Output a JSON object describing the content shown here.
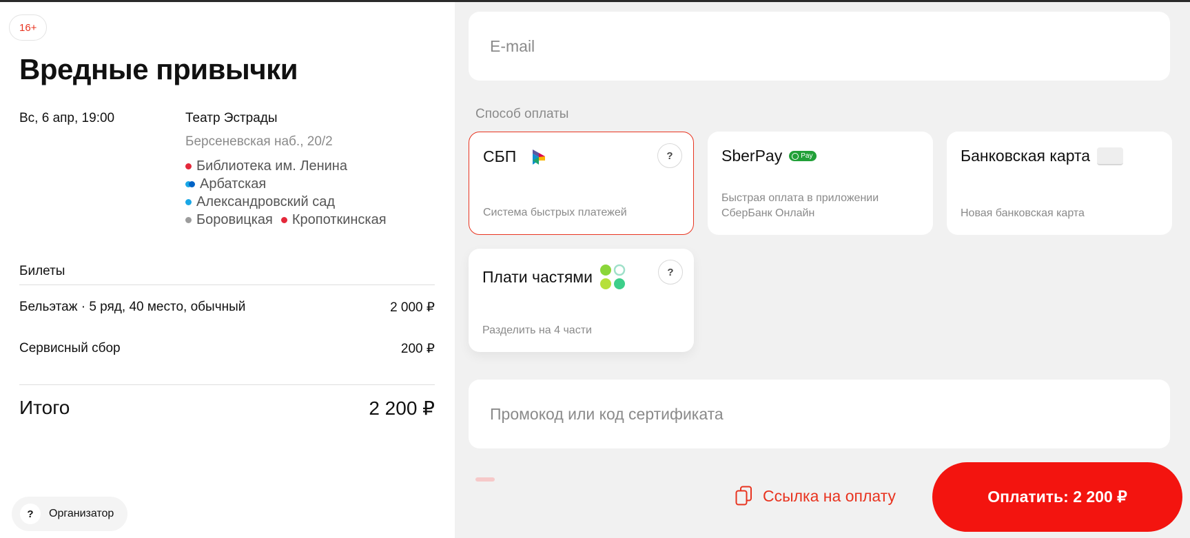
{
  "event": {
    "age_rating": "16+",
    "title": "Вредные привычки",
    "date": "Вс, 6 апр, 19:00",
    "venue_name": "Театр Эстрады",
    "venue_address": "Берсеневская наб., 20/2",
    "metro": [
      {
        "name": "Библиотека им. Ленина",
        "color": "#e4283a"
      },
      {
        "name": "Арбатская",
        "color": "#1aa7e6"
      },
      {
        "name": "Александровский сад",
        "color": "#1aa7e6"
      },
      {
        "name": "Боровицкая",
        "color": "#9c9c9c"
      },
      {
        "name": "Кропоткинская",
        "color": "#e4283a"
      }
    ]
  },
  "order": {
    "tickets_label": "Билеты",
    "ticket_description": "Бельэтаж · 5 ряд, 40 место, обычный",
    "ticket_price": "2 000 ₽",
    "service_fee_label": "Сервисный сбор",
    "service_fee_price": "200 ₽",
    "total_label": "Итого",
    "total_price": "2 200 ₽"
  },
  "organizer": {
    "icon": "?",
    "label": "Организатор"
  },
  "form": {
    "email_placeholder": "E-mail",
    "payment_method_label": "Способ оплаты",
    "payment_methods": [
      {
        "id": "sbp",
        "title": "СБП",
        "description": "Система быстрых платежей",
        "selected": true,
        "help": "?"
      },
      {
        "id": "sberpay",
        "title": "SberPay",
        "badge": "Pay",
        "description": "Быстрая оплата в приложении СберБанк Онлайн",
        "selected": false
      },
      {
        "id": "bank-card",
        "title": "Банковская карта",
        "description": "Новая банковская карта",
        "selected": false
      },
      {
        "id": "installments",
        "title": "Плати частями",
        "description": "Разделить на 4 части",
        "selected": false,
        "help": "?"
      }
    ],
    "promo_placeholder": "Промокод или код сертификата",
    "payment_link_label": "Ссылка на оплату",
    "pay_button_label": "Оплатить: 2 200 ₽"
  },
  "colors": {
    "accent": "#e8331f",
    "pay_button": "#f3140f",
    "panel_bg": "#f1f1f1",
    "sberpay_green": "#21a038"
  }
}
